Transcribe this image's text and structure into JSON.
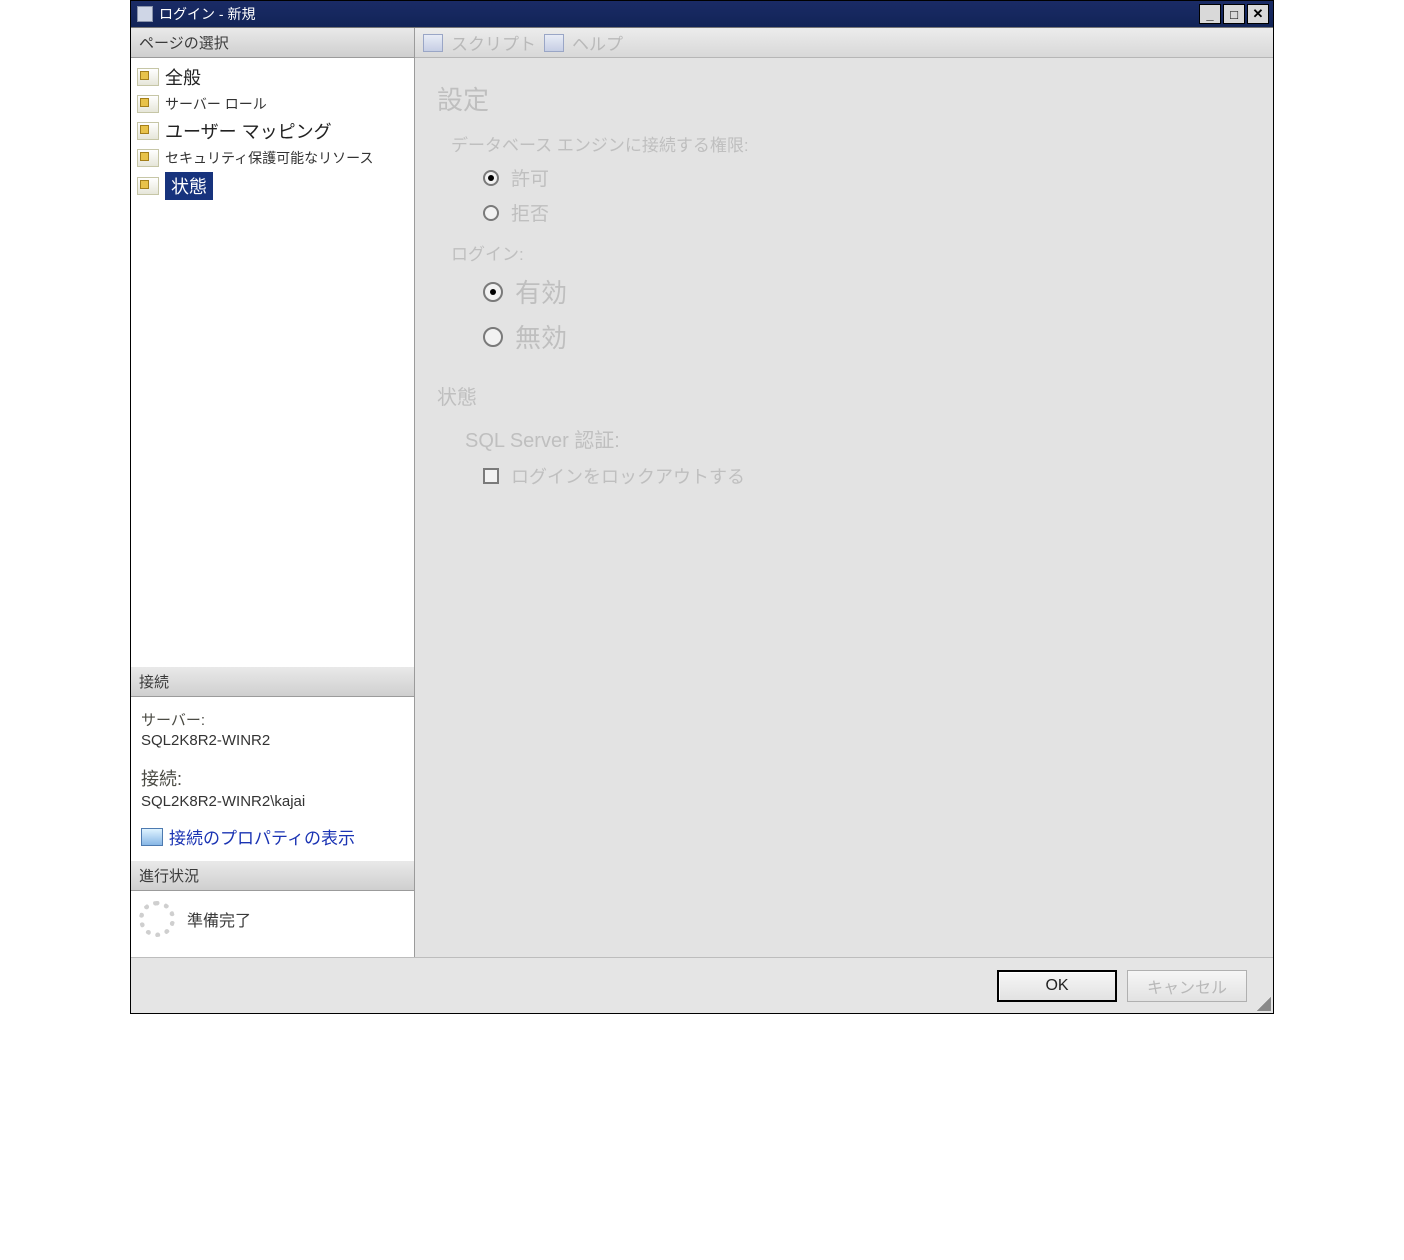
{
  "title": "ログイン - 新規",
  "sidebar": {
    "header": "ページの選択",
    "items": [
      {
        "label": "全般",
        "size": "l"
      },
      {
        "label": "サーバー ロール",
        "size": "s"
      },
      {
        "label": "ユーザー マッピング",
        "size": "l"
      },
      {
        "label": "セキュリティ保護可能なリソース",
        "size": "s"
      },
      {
        "label": "状態",
        "size": "l",
        "selected": true
      }
    ],
    "connection": {
      "header": "接続",
      "server_label": "サーバー:",
      "server_value": "SQL2K8R2-WINR2",
      "conn_label": "接続:",
      "conn_value": "SQL2K8R2-WINR2\\kajai",
      "link": "接続のプロパティの表示"
    },
    "progress": {
      "header": "進行状況",
      "status": "準備完了"
    }
  },
  "toolbar": {
    "script": "スクリプト",
    "help": "ヘルプ"
  },
  "content": {
    "settings_header": "設定",
    "perm_group_label": "データベース エンジンに接続する権限:",
    "perm_grant": "許可",
    "perm_deny": "拒否",
    "login_group_label": "ログイン:",
    "login_enabled": "有効",
    "login_disabled": "無効",
    "status_header": "状態",
    "sqlauth_label": "SQL Server 認証:",
    "lockout_label": "ログインをロックアウトする"
  },
  "footer": {
    "ok": "OK",
    "cancel": "キャンセル"
  }
}
